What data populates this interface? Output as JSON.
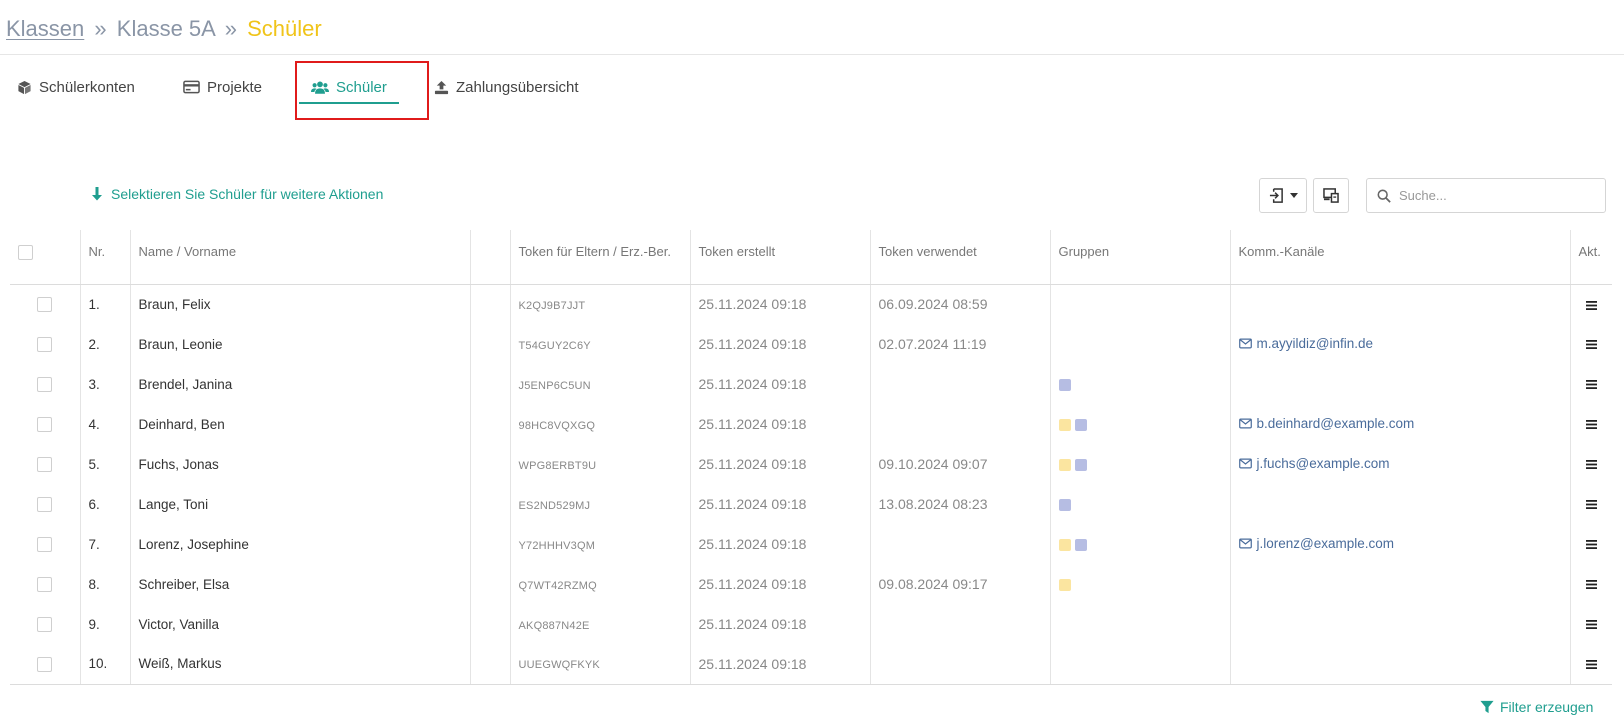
{
  "breadcrumb": {
    "items": [
      "Klassen",
      "Klasse 5A"
    ],
    "separator": "»",
    "current": "Schüler"
  },
  "tabs": [
    {
      "label": "Schülerkonten",
      "icon": "cube-icon",
      "active": false
    },
    {
      "label": "Projekte",
      "icon": "credit-card-icon",
      "active": false
    },
    {
      "label": "Schüler",
      "icon": "users-icon",
      "active": true
    },
    {
      "label": "Zahlungsübersicht",
      "icon": "upload-icon",
      "active": false
    }
  ],
  "toolbar": {
    "select_hint": "Selektieren Sie Schüler für weitere Aktionen",
    "search_placeholder": "Suche..."
  },
  "table": {
    "headers": {
      "nr": "Nr.",
      "name": "Name / Vorname",
      "token": "Token für Eltern / Erz.-Ber.",
      "token_created": "Token erstellt",
      "token_used": "Token verwendet",
      "groups": "Gruppen",
      "channels": "Komm.-Kanäle",
      "actions": "Akt."
    },
    "rows": [
      {
        "nr": "1.",
        "name": "Braun, Felix",
        "token": "K2QJ9B7JJT",
        "created": "25.11.2024 09:18",
        "used": "06.09.2024 08:59",
        "groups": [],
        "email": ""
      },
      {
        "nr": "2.",
        "name": "Braun, Leonie",
        "token": "T54GUY2C6Y",
        "created": "25.11.2024 09:18",
        "used": "02.07.2024 11:19",
        "groups": [],
        "email": "m.ayyildiz@infin.de"
      },
      {
        "nr": "3.",
        "name": "Brendel, Janina",
        "token": "J5ENP6C5UN",
        "created": "25.11.2024 09:18",
        "used": "",
        "groups": [
          "purple"
        ],
        "email": ""
      },
      {
        "nr": "4.",
        "name": "Deinhard, Ben",
        "token": "98HC8VQXGQ",
        "created": "25.11.2024 09:18",
        "used": "",
        "groups": [
          "yellow",
          "purple"
        ],
        "email": "b.deinhard@example.com"
      },
      {
        "nr": "5.",
        "name": "Fuchs, Jonas",
        "token": "WPG8ERBT9U",
        "created": "25.11.2024 09:18",
        "used": "09.10.2024 09:07",
        "groups": [
          "yellow",
          "purple"
        ],
        "email": "j.fuchs@example.com"
      },
      {
        "nr": "6.",
        "name": "Lange, Toni",
        "token": "ES2ND529MJ",
        "created": "25.11.2024 09:18",
        "used": "13.08.2024 08:23",
        "groups": [
          "purple"
        ],
        "email": ""
      },
      {
        "nr": "7.",
        "name": "Lorenz, Josephine",
        "token": "Y72HHHV3QM",
        "created": "25.11.2024 09:18",
        "used": "",
        "groups": [
          "yellow",
          "purple"
        ],
        "email": "j.lorenz@example.com"
      },
      {
        "nr": "8.",
        "name": "Schreiber, Elsa",
        "token": "Q7WT42RZMQ",
        "created": "25.11.2024 09:18",
        "used": "09.08.2024 09:17",
        "groups": [
          "yellow"
        ],
        "email": ""
      },
      {
        "nr": "9.",
        "name": "Victor, Vanilla",
        "token": "AKQ887N42E",
        "created": "25.11.2024 09:18",
        "used": "",
        "groups": [],
        "email": ""
      },
      {
        "nr": "10.",
        "name": "Weiß, Markus",
        "token": "UUEGWQFKYK",
        "created": "25.11.2024 09:18",
        "used": "",
        "groups": [],
        "email": ""
      }
    ]
  },
  "footer": {
    "filter_label": "Filter erzeugen"
  },
  "colors": {
    "accent": "#1f9e8f",
    "breadcrumb_current": "#f0c419",
    "group_yellow": "#fbe5a0",
    "group_purple": "#b6bde3",
    "highlight_box": "#e01b1b"
  }
}
